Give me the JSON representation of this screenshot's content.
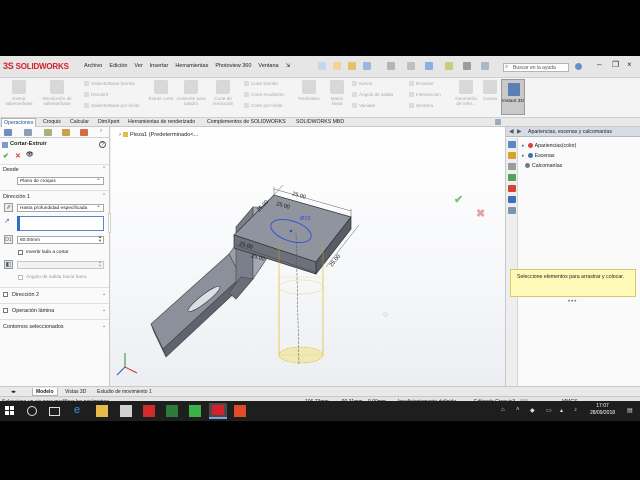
{
  "app": {
    "logo_text": "SOLIDWORKS",
    "logo_mark": "3S"
  },
  "menu": {
    "items": [
      "Archivo",
      "Edición",
      "Ver",
      "Insertar",
      "Herramientas",
      "Photoview 360",
      "Ventana"
    ],
    "pin": "⇲"
  },
  "search": {
    "placeholder": "Buscar en la ayuda"
  },
  "window_controls": {
    "minimize": "–",
    "restore": "❐",
    "close": "×"
  },
  "ribbon": {
    "big_buttons": [
      {
        "label": "Extruir saliente/base"
      },
      {
        "label": "Revolución de saliente/base"
      },
      {
        "label": "Extruir corte"
      },
      {
        "label": "Asistente para taladro"
      },
      {
        "label": "Corte de revolución"
      },
      {
        "label": "Redondeo"
      },
      {
        "label": "Matriz lineal"
      },
      {
        "label": "Geometría de refer..."
      },
      {
        "label": "Curvas"
      }
    ],
    "small_buttons": [
      "Saliente/Base barrido",
      "Recubrir",
      "Saliente/Base por límite",
      "Corte barrido",
      "Corte recubierto",
      "Corte por límite",
      "Nervio",
      "Ángulo de salida",
      "Vaciado",
      "Envolver",
      "Intersección",
      "Simetría"
    ],
    "instant3d": "Instant 3D"
  },
  "command_tabs": [
    "Operaciones",
    "Croquis",
    "Calcular",
    "DimXpert",
    "Herramientas de renderizado",
    "Complementos de SOLIDWORKS",
    "SOLIDWORKS MBD"
  ],
  "property_manager": {
    "title": "Cortar-Extruir",
    "help": "?",
    "ok": "✔",
    "cancel": "✕",
    "preview": "👁",
    "from_label": "Desde",
    "from_value": "Plano de croquis",
    "direction1_label": "Dirección 1",
    "direction1_value": "Hasta profundidad especificada",
    "depth_value": "60.00mm",
    "invert_label": "Invertir lado a cortar",
    "draft_label": "Ángulo de salida hacia fuera",
    "direction2_label": "Dirección 2",
    "thin_label": "Operación lámina",
    "contours_label": "Contornos seleccionados"
  },
  "viewport": {
    "breadcrumb": "Pieza1  (Predeterminado<...",
    "dimensions": [
      "25.00",
      "25.00",
      "25.00",
      "25.00",
      "25.00",
      "25.00",
      "Ø10"
    ]
  },
  "task_pane": {
    "title": "Apariencias, escenas y calcomanías",
    "tree": [
      {
        "label": "Apariencias(color)",
        "color": "#d0443a"
      },
      {
        "label": "Escenas",
        "color": "#3d6fb6"
      },
      {
        "label": "Calcomanías",
        "color": "#7b7b7b"
      }
    ],
    "note": "Seleccione elementos para arrastrar y colocar."
  },
  "model_tabs": [
    "Modelo",
    "Vistas 3D",
    "Estudio de movimiento 1"
  ],
  "status": {
    "message": "Seleccione un eje para modificar los parámetros",
    "x": "106.73mm",
    "y": "-90.31mm",
    "z": "0.00mm",
    "defined": "Insuficientemente definido",
    "editing": "Editando Croquis3",
    "units": "MMGS"
  },
  "taskbar": {
    "time": "17:07",
    "date": "28/09/2018"
  },
  "colors": {
    "accent": "#1a4d8f",
    "solidworks_red": "#d4202c",
    "model_gray": "#8a8f99",
    "preview_yellow": "#f2d400"
  }
}
